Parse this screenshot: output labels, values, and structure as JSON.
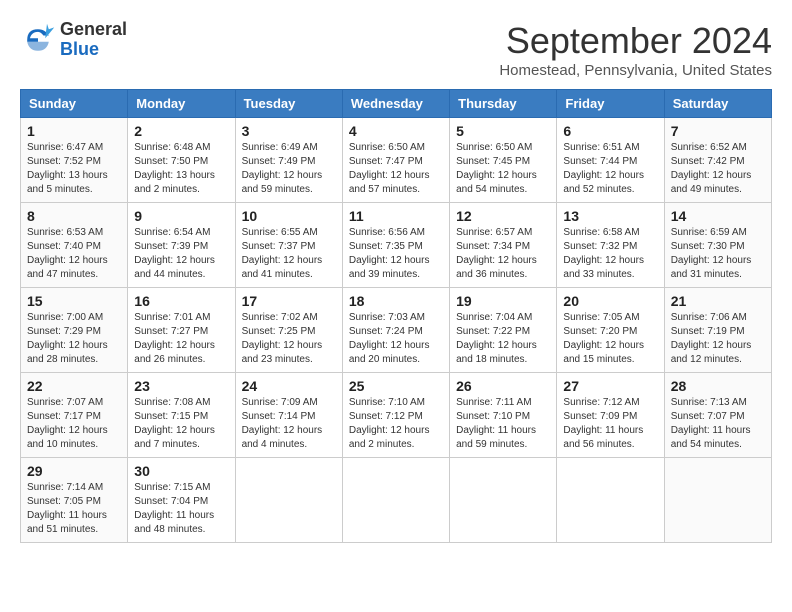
{
  "header": {
    "logo_line1": "General",
    "logo_line2": "Blue",
    "month_title": "September 2024",
    "subtitle": "Homestead, Pennsylvania, United States"
  },
  "weekdays": [
    "Sunday",
    "Monday",
    "Tuesday",
    "Wednesday",
    "Thursday",
    "Friday",
    "Saturday"
  ],
  "weeks": [
    [
      {
        "day": 1,
        "lines": [
          "Sunrise: 6:47 AM",
          "Sunset: 7:52 PM",
          "Daylight: 13 hours",
          "and 5 minutes."
        ]
      },
      {
        "day": 2,
        "lines": [
          "Sunrise: 6:48 AM",
          "Sunset: 7:50 PM",
          "Daylight: 13 hours",
          "and 2 minutes."
        ]
      },
      {
        "day": 3,
        "lines": [
          "Sunrise: 6:49 AM",
          "Sunset: 7:49 PM",
          "Daylight: 12 hours",
          "and 59 minutes."
        ]
      },
      {
        "day": 4,
        "lines": [
          "Sunrise: 6:50 AM",
          "Sunset: 7:47 PM",
          "Daylight: 12 hours",
          "and 57 minutes."
        ]
      },
      {
        "day": 5,
        "lines": [
          "Sunrise: 6:50 AM",
          "Sunset: 7:45 PM",
          "Daylight: 12 hours",
          "and 54 minutes."
        ]
      },
      {
        "day": 6,
        "lines": [
          "Sunrise: 6:51 AM",
          "Sunset: 7:44 PM",
          "Daylight: 12 hours",
          "and 52 minutes."
        ]
      },
      {
        "day": 7,
        "lines": [
          "Sunrise: 6:52 AM",
          "Sunset: 7:42 PM",
          "Daylight: 12 hours",
          "and 49 minutes."
        ]
      }
    ],
    [
      {
        "day": 8,
        "lines": [
          "Sunrise: 6:53 AM",
          "Sunset: 7:40 PM",
          "Daylight: 12 hours",
          "and 47 minutes."
        ]
      },
      {
        "day": 9,
        "lines": [
          "Sunrise: 6:54 AM",
          "Sunset: 7:39 PM",
          "Daylight: 12 hours",
          "and 44 minutes."
        ]
      },
      {
        "day": 10,
        "lines": [
          "Sunrise: 6:55 AM",
          "Sunset: 7:37 PM",
          "Daylight: 12 hours",
          "and 41 minutes."
        ]
      },
      {
        "day": 11,
        "lines": [
          "Sunrise: 6:56 AM",
          "Sunset: 7:35 PM",
          "Daylight: 12 hours",
          "and 39 minutes."
        ]
      },
      {
        "day": 12,
        "lines": [
          "Sunrise: 6:57 AM",
          "Sunset: 7:34 PM",
          "Daylight: 12 hours",
          "and 36 minutes."
        ]
      },
      {
        "day": 13,
        "lines": [
          "Sunrise: 6:58 AM",
          "Sunset: 7:32 PM",
          "Daylight: 12 hours",
          "and 33 minutes."
        ]
      },
      {
        "day": 14,
        "lines": [
          "Sunrise: 6:59 AM",
          "Sunset: 7:30 PM",
          "Daylight: 12 hours",
          "and 31 minutes."
        ]
      }
    ],
    [
      {
        "day": 15,
        "lines": [
          "Sunrise: 7:00 AM",
          "Sunset: 7:29 PM",
          "Daylight: 12 hours",
          "and 28 minutes."
        ]
      },
      {
        "day": 16,
        "lines": [
          "Sunrise: 7:01 AM",
          "Sunset: 7:27 PM",
          "Daylight: 12 hours",
          "and 26 minutes."
        ]
      },
      {
        "day": 17,
        "lines": [
          "Sunrise: 7:02 AM",
          "Sunset: 7:25 PM",
          "Daylight: 12 hours",
          "and 23 minutes."
        ]
      },
      {
        "day": 18,
        "lines": [
          "Sunrise: 7:03 AM",
          "Sunset: 7:24 PM",
          "Daylight: 12 hours",
          "and 20 minutes."
        ]
      },
      {
        "day": 19,
        "lines": [
          "Sunrise: 7:04 AM",
          "Sunset: 7:22 PM",
          "Daylight: 12 hours",
          "and 18 minutes."
        ]
      },
      {
        "day": 20,
        "lines": [
          "Sunrise: 7:05 AM",
          "Sunset: 7:20 PM",
          "Daylight: 12 hours",
          "and 15 minutes."
        ]
      },
      {
        "day": 21,
        "lines": [
          "Sunrise: 7:06 AM",
          "Sunset: 7:19 PM",
          "Daylight: 12 hours",
          "and 12 minutes."
        ]
      }
    ],
    [
      {
        "day": 22,
        "lines": [
          "Sunrise: 7:07 AM",
          "Sunset: 7:17 PM",
          "Daylight: 12 hours",
          "and 10 minutes."
        ]
      },
      {
        "day": 23,
        "lines": [
          "Sunrise: 7:08 AM",
          "Sunset: 7:15 PM",
          "Daylight: 12 hours",
          "and 7 minutes."
        ]
      },
      {
        "day": 24,
        "lines": [
          "Sunrise: 7:09 AM",
          "Sunset: 7:14 PM",
          "Daylight: 12 hours",
          "and 4 minutes."
        ]
      },
      {
        "day": 25,
        "lines": [
          "Sunrise: 7:10 AM",
          "Sunset: 7:12 PM",
          "Daylight: 12 hours",
          "and 2 minutes."
        ]
      },
      {
        "day": 26,
        "lines": [
          "Sunrise: 7:11 AM",
          "Sunset: 7:10 PM",
          "Daylight: 11 hours",
          "and 59 minutes."
        ]
      },
      {
        "day": 27,
        "lines": [
          "Sunrise: 7:12 AM",
          "Sunset: 7:09 PM",
          "Daylight: 11 hours",
          "and 56 minutes."
        ]
      },
      {
        "day": 28,
        "lines": [
          "Sunrise: 7:13 AM",
          "Sunset: 7:07 PM",
          "Daylight: 11 hours",
          "and 54 minutes."
        ]
      }
    ],
    [
      {
        "day": 29,
        "lines": [
          "Sunrise: 7:14 AM",
          "Sunset: 7:05 PM",
          "Daylight: 11 hours",
          "and 51 minutes."
        ]
      },
      {
        "day": 30,
        "lines": [
          "Sunrise: 7:15 AM",
          "Sunset: 7:04 PM",
          "Daylight: 11 hours",
          "and 48 minutes."
        ]
      },
      null,
      null,
      null,
      null,
      null
    ]
  ]
}
